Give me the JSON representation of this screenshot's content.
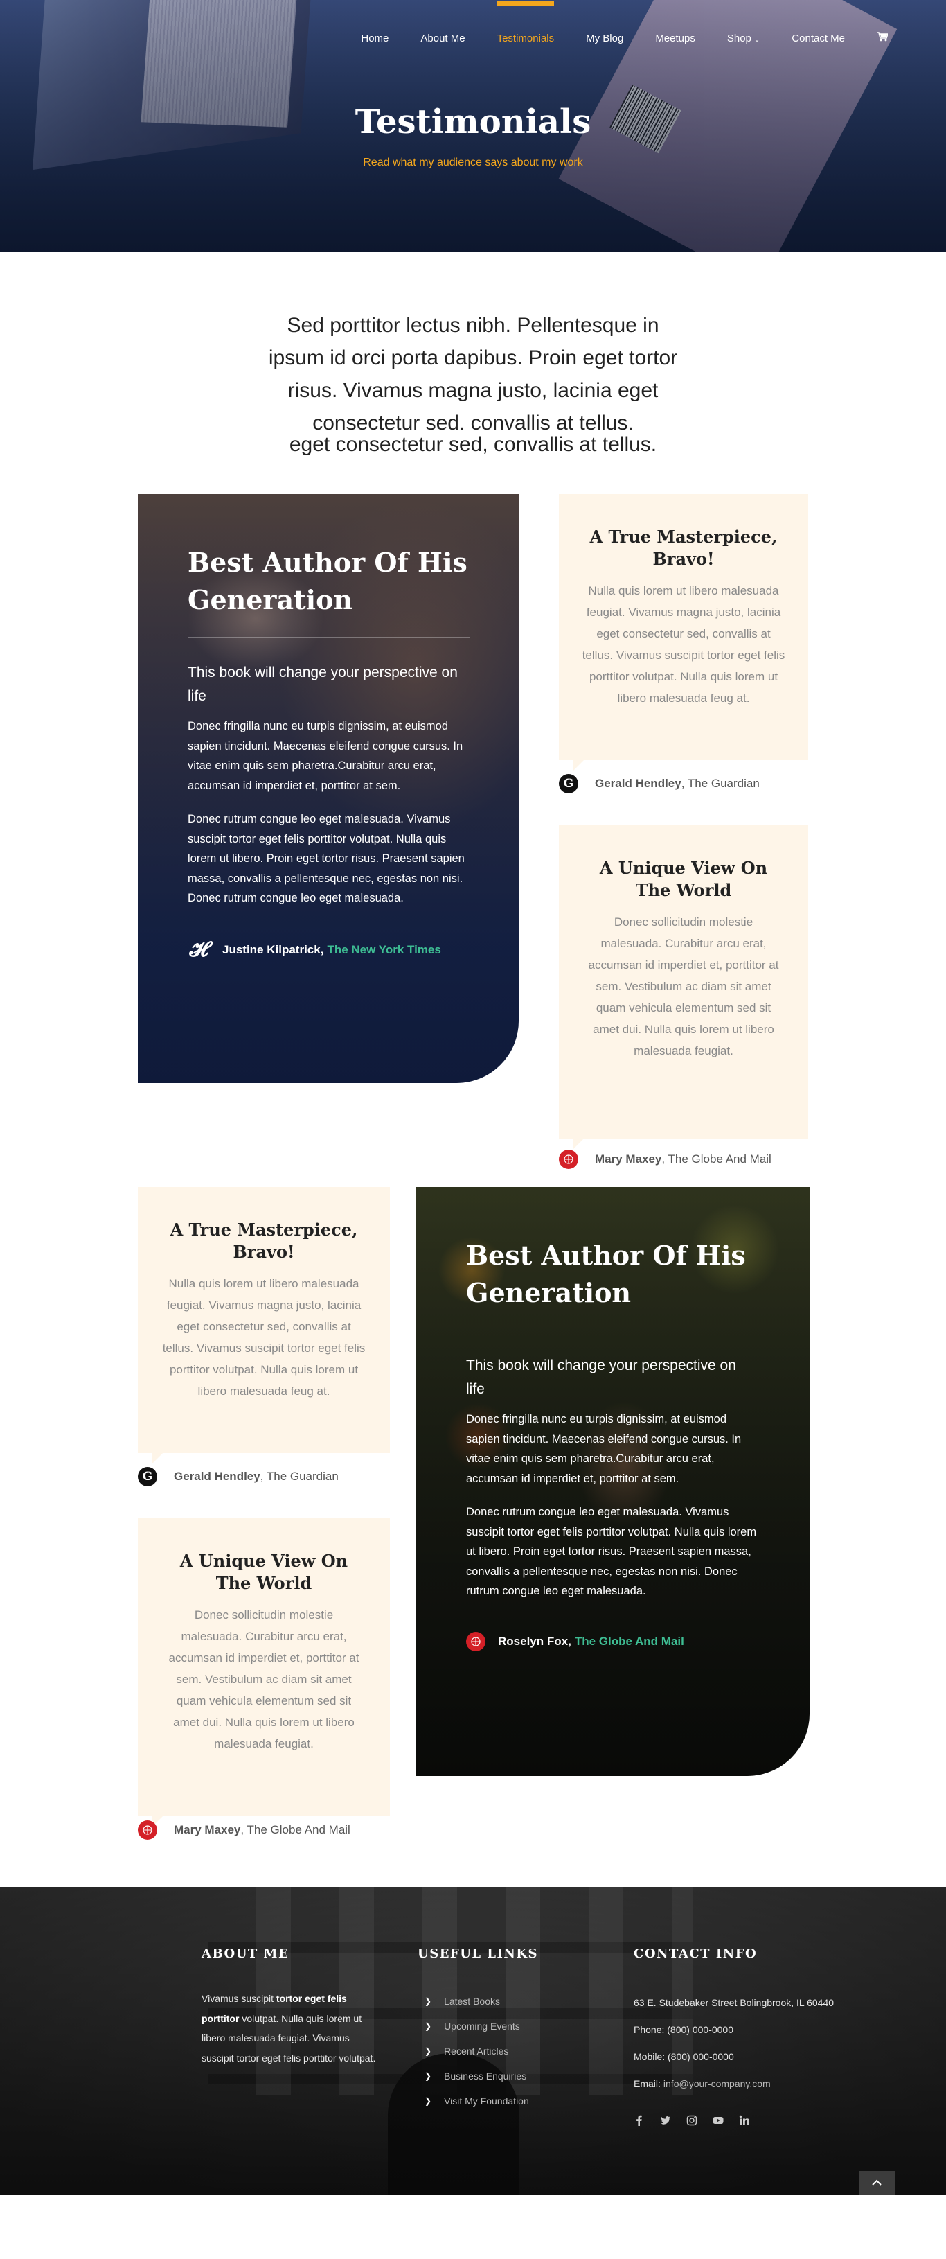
{
  "nav": {
    "items": [
      "Home",
      "About Me",
      "Testimonials",
      "My Blog",
      "Meetups",
      "Shop",
      "Contact Me"
    ],
    "active": "Testimonials",
    "accent": "#f4a71d",
    "cart_icon": "cart-icon"
  },
  "hero": {
    "title": "Testimonials",
    "subtitle": "Read what my audience says about my work"
  },
  "intro": {
    "text": "Sed porttitor lectus nibh. Pellentesque in ipsum id orci porta dapibus. Proin eget tortor risus. Vivamus magna justo, lacinia eget consectetur sed. convallis at tellus.",
    "tail": "eget consectetur sed, convallis at tellus."
  },
  "features": [
    {
      "title": "Best Author Of His Generation",
      "lead": "This book will change your perspective on life",
      "p1": "Donec fringilla nunc eu turpis dignissim, at euismod sapien tincidunt. Maecenas eleifend congue cursus. In vitae enim quis sem pharetra.Curabitur arcu erat, accumsan id imperdiet et, porttitor at sem.",
      "p2": "Donec rutrum congue leo eget malesuada. Vivamus suscipit tortor eget felis porttitor volutpat. Nulla quis lorem ut libero. Proin eget tortor risus. Praesent sapien massa, convallis a pellentesque nec, egestas non nisi. Donec rutrum congue leo eget malesuada.",
      "name": "Justine Kilpatrick,",
      "publication": "The New York Times",
      "logo": "nyt-logo-icon"
    },
    {
      "title": "Best Author Of His Generation",
      "lead": "This book will change your perspective on life",
      "p1": "Donec fringilla nunc eu turpis dignissim, at euismod sapien tincidunt. Maecenas eleifend congue cursus. In vitae enim quis sem pharetra.Curabitur arcu erat, accumsan id imperdiet et, porttitor at sem.",
      "p2": "Donec rutrum congue leo eget malesuada. Vivamus suscipit tortor eget felis porttitor volutpat. Nulla quis lorem ut libero. Proin eget tortor risus. Praesent sapien massa, convallis a pellentesque nec, egestas non nisi. Donec rutrum congue leo eget malesuada.",
      "name": "Roselyn Fox,",
      "publication": "The Globe And Mail",
      "logo": "globe-mail-logo-icon"
    }
  ],
  "cards": {
    "masterpiece": {
      "title": "A True Masterpiece, Bravo!",
      "body": "Nulla quis lorem ut libero malesuada feugiat. Vivamus magna justo, lacinia eget consectetur sed, convallis at tellus. Vivamus suscipit tortor eget felis porttitor volutpat. Nulla quis lorem ut libero malesuada feug at.",
      "name": "Gerald Hendley",
      "publication": ", The Guardian"
    },
    "unique": {
      "title": "A Unique View On The World",
      "body": "Donec sollicitudin molestie malesuada. Curabitur arcu erat, accumsan id imperdiet et, porttitor at sem. Vestibulum ac diam sit amet quam vehicula elementum sed sit amet dui. Nulla quis lorem ut libero malesuada feugiat.",
      "name": "Mary Maxey",
      "publication": ", The Globe And Mail"
    }
  },
  "footer": {
    "about": {
      "heading": "ABOUT ME",
      "pre": "Vivamus suscipit ",
      "bold": "tortor eget felis porttitor",
      "post": " volutpat. Nulla quis lorem ut libero malesuada feugiat. Vivamus suscipit tortor eget felis porttitor volutpat."
    },
    "links": {
      "heading": "USEFUL LINKS",
      "items": [
        "Latest Books",
        "Upcoming Events",
        "Recent Articles",
        "Business Enquiries",
        "Visit My Foundation"
      ]
    },
    "contact": {
      "heading": "CONTACT INFO",
      "address": "63 E. Studebaker Street Bolingbrook, IL 60440",
      "phone": "Phone: (800) 000-0000",
      "mobile": "Mobile: (800) 000-0000",
      "email_label": "Email:",
      "email": "info@your-company.com"
    },
    "socials": [
      "facebook-icon",
      "twitter-icon",
      "instagram-icon",
      "youtube-icon",
      "linkedin-icon"
    ]
  }
}
